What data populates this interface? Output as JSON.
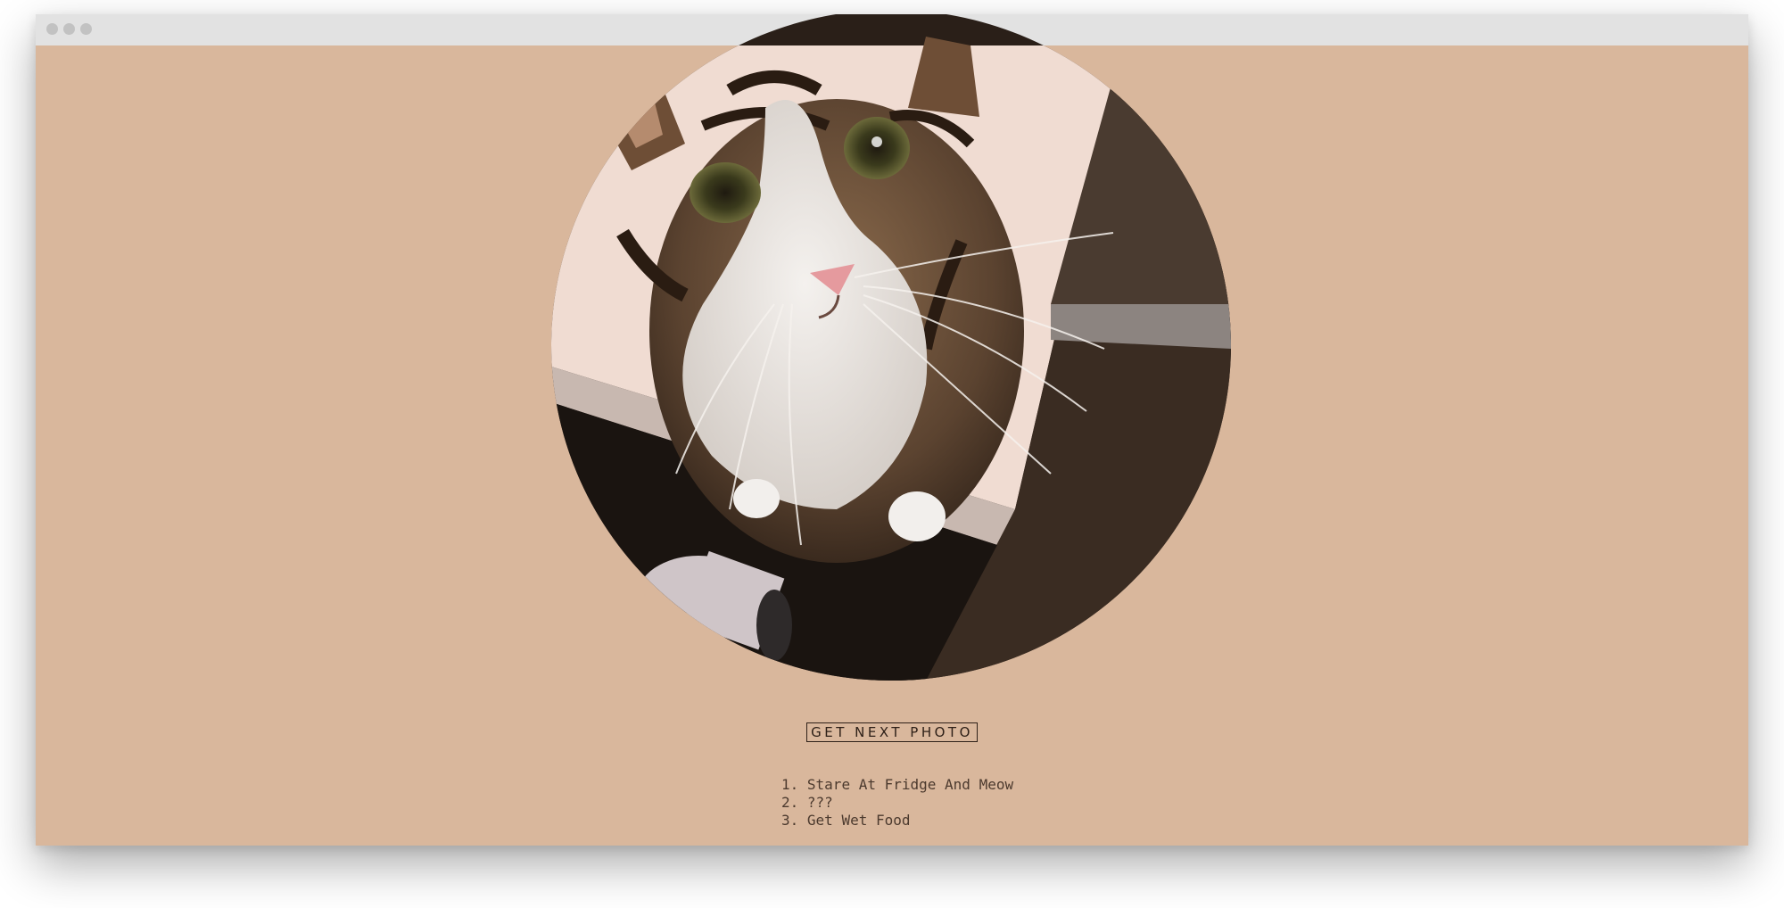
{
  "window": {
    "background": "#d9b79c",
    "titlebar_color": "#e2e2e2"
  },
  "photo": {
    "subject": "cat photo",
    "shape": "oval"
  },
  "next_photo_button": {
    "label": "GET NEXT PHOTO"
  },
  "steps": [
    {
      "number": "1.",
      "text": "Stare At Fridge And Meow"
    },
    {
      "number": "2.",
      "text": "???"
    },
    {
      "number": "3.",
      "text": "Get Wet Food"
    }
  ]
}
